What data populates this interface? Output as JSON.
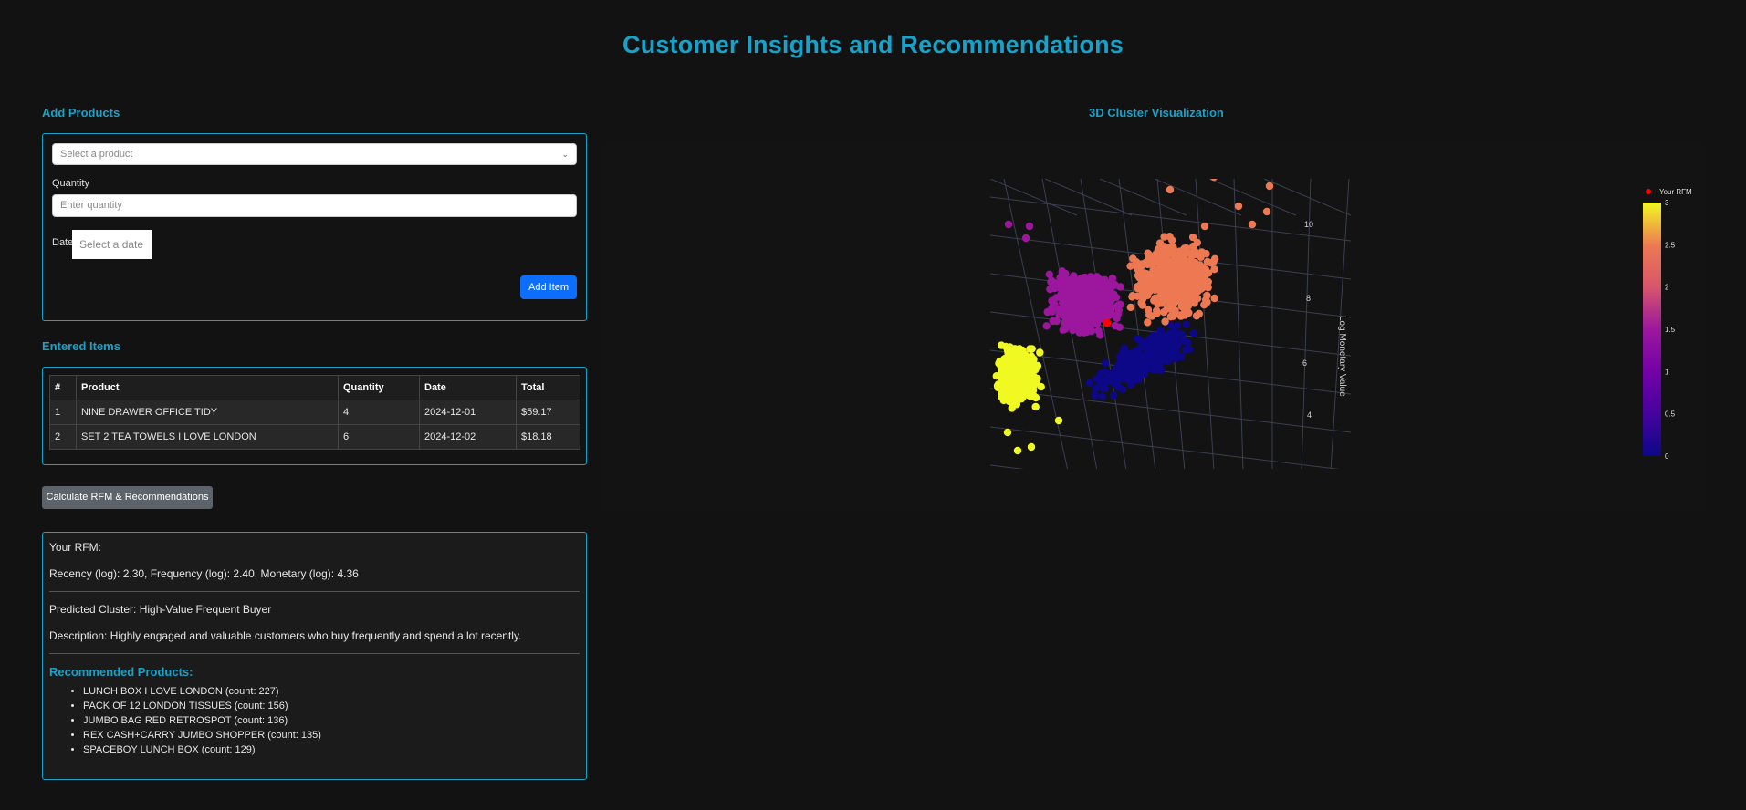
{
  "page_title": "Customer Insights and Recommendations",
  "add_products": {
    "heading": "Add Products",
    "product_placeholder": "Select a product",
    "quantity_label": "Quantity",
    "quantity_placeholder": "Enter quantity",
    "date_label": "Date",
    "date_placeholder": "Select a date",
    "add_button": "Add Item",
    "button_color": "#0d6efd"
  },
  "entered_items": {
    "heading": "Entered Items",
    "columns": [
      "#",
      "Product",
      "Quantity",
      "Date",
      "Total"
    ],
    "rows": [
      [
        "1",
        "NINE DRAWER OFFICE TIDY",
        "4",
        "2024-12-01",
        "$59.17"
      ],
      [
        "2",
        "SET 2 TEA TOWELS I LOVE LONDON",
        "6",
        "2024-12-02",
        "$18.18"
      ]
    ]
  },
  "calculate_button": "Calculate RFM & Recommendations",
  "results": {
    "rfm_heading": "Your RFM:",
    "rfm_values": "Recency (log): 2.30, Frequency (log): 2.40, Monetary (log): 4.36",
    "predicted_cluster": "Predicted Cluster: High-Value Frequent Buyer",
    "description": "Description: Highly engaged and valuable customers who buy frequently and spend a lot recently.",
    "recommended_heading": "Recommended Products:",
    "recommendations": [
      "LUNCH BOX I LOVE LONDON (count: 227)",
      "PACK OF 12 LONDON TISSUES (count: 156)",
      "JUMBO BAG RED RETROSPOT (count: 136)",
      "REX CASH+CARRY JUMBO SHOPPER (count: 135)",
      "SPACEBOY LUNCH BOX (count: 129)"
    ]
  },
  "accent_color": "#17a2c9",
  "visualization": {
    "heading": "3D Cluster Visualization",
    "legend_label": "Your RFM",
    "chart_data": {
      "type": "scatter",
      "zlabel": "Log Monetary Value",
      "ztick_labels": [
        "4",
        "6",
        "8",
        "10"
      ],
      "colorbar_ticks": [
        "0",
        "0.5",
        "1",
        "1.5",
        "2",
        "2.5",
        "3"
      ],
      "colorbar_range": [
        0,
        3
      ],
      "clusters": [
        {
          "cluster": 0,
          "color": "#0d0887"
        },
        {
          "cluster": 1,
          "color": "#9c179e"
        },
        {
          "cluster": 2,
          "color": "#ed7953"
        },
        {
          "cluster": 3,
          "color": "#f0f921"
        }
      ],
      "your_rfm": {
        "recency": 2.3,
        "frequency": 2.4,
        "monetary": 4.36,
        "color": "#ff0000"
      }
    }
  }
}
